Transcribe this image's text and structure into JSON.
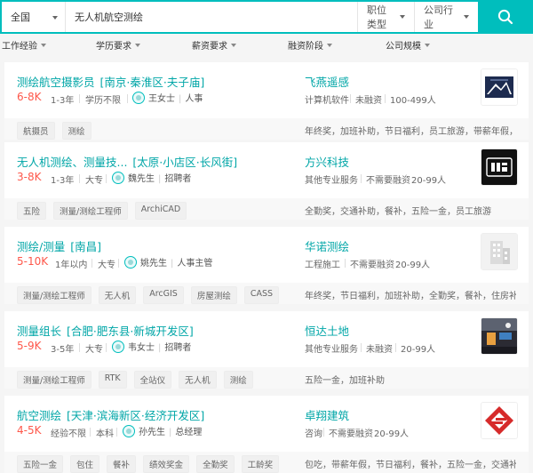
{
  "search": {
    "city": "全国",
    "query": "无人机航空测绘",
    "job_type": "职位类型",
    "industry": "公司行业",
    "colors": {
      "accent": "#00bebd",
      "salary": "#fe574a"
    }
  },
  "filters": [
    "工作经验",
    "学历要求",
    "薪资要求",
    "融资阶段",
    "公司规模"
  ],
  "jobs": [
    {
      "title": "测绘航空摄影员",
      "location": "[南京·秦淮区·夫子庙]",
      "salary": "6-8K",
      "experience": "1-3年",
      "education": "学历不限",
      "recruiter": "王女士",
      "recruiter_role": "人事",
      "company": "飞燕遥感",
      "company_meta": [
        "计算机软件",
        "未融资",
        "100-499人"
      ],
      "tags": [
        "航摄员",
        "测绘"
      ],
      "benefits": "年终奖，加班补助，节日福利，员工旅游，带薪年假，五..."
    },
    {
      "title": "无人机测绘、测量技...",
      "location": "[太原·小店区·长风街]",
      "salary": "3-8K",
      "experience": "1-3年",
      "education": "大专",
      "recruiter": "魏先生",
      "recruiter_role": "招聘者",
      "company": "方兴科技",
      "company_meta": [
        "其他专业服务",
        "不需要融资",
        "20-99人"
      ],
      "tags": [
        "五险",
        "测量/测绘工程师",
        "ArchiCAD"
      ],
      "benefits": "全勤奖，交通补助，餐补，五险一金，员工旅游"
    },
    {
      "title": "测绘/测量",
      "location": "[南昌]",
      "salary": "5-10K",
      "experience": "1年以内",
      "education": "大专",
      "recruiter": "姚先生",
      "recruiter_role": "人事主管",
      "company": "华诺测绘",
      "company_meta": [
        "工程施工",
        "不需要融资",
        "20-99人"
      ],
      "tags": [
        "测量/测绘工程师",
        "无人机",
        "ArcGIS",
        "房屋测绘",
        "CASS"
      ],
      "benefits": "年终奖，节日福利，加班补助，全勤奖，餐补，住房补贴..."
    },
    {
      "title": "测量组长",
      "location": "[合肥·肥东县·新城开发区]",
      "salary": "5-9K",
      "experience": "3-5年",
      "education": "大专",
      "recruiter": "韦女士",
      "recruiter_role": "招聘者",
      "company": "恒达土地",
      "company_meta": [
        "其他专业服务",
        "未融资",
        "20-99人"
      ],
      "tags": [
        "测量/测绘工程师",
        "RTK",
        "全站仪",
        "无人机",
        "测绘"
      ],
      "benefits": "五险一金，加班补助"
    },
    {
      "title": "航空测绘",
      "location": "[天津·滨海新区·经济开发区]",
      "salary": "4-5K",
      "experience": "经验不限",
      "education": "本科",
      "recruiter": "孙先生",
      "recruiter_role": "总经理",
      "company": "卓翔建筑",
      "company_meta": [
        "咨询",
        "不需要融资",
        "20-99人"
      ],
      "tags": [
        "五险一金",
        "包住",
        "餐补",
        "绩效奖金",
        "全勤奖",
        "工龄奖"
      ],
      "benefits": "包吃，带薪年假，节日福利，餐补，五险一金，交通补助..."
    }
  ]
}
